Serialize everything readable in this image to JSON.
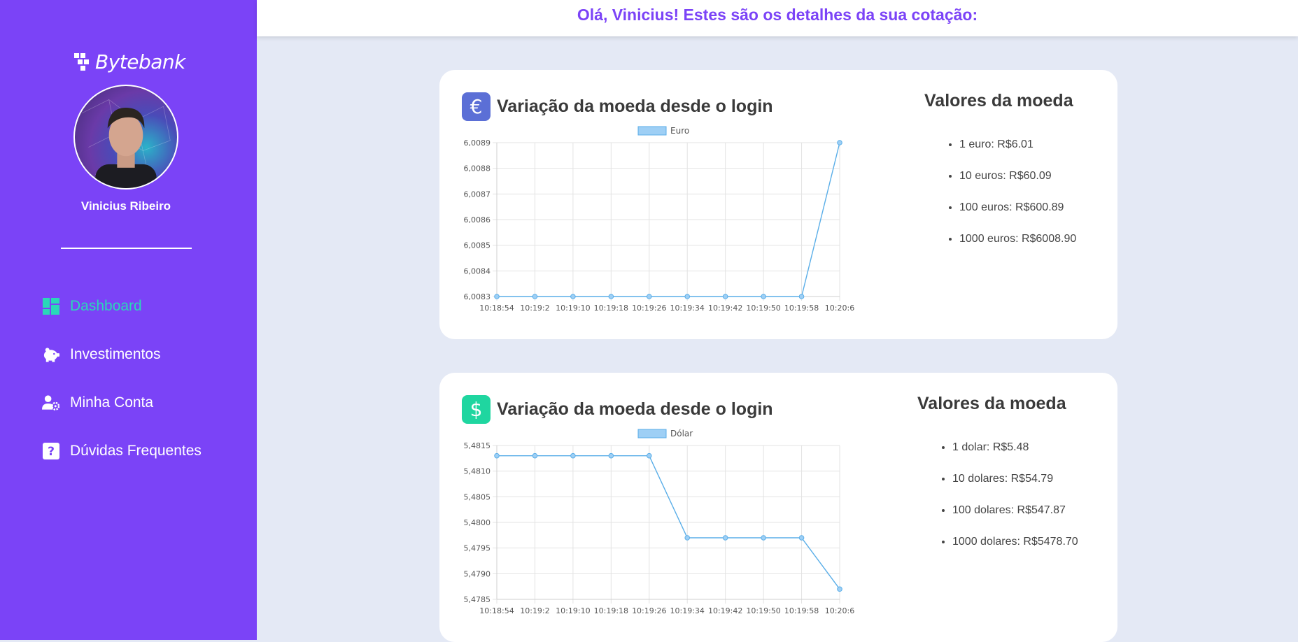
{
  "sidebar": {
    "brand": "Bytebank",
    "user_name": "Vinicius Ribeiro",
    "nav": [
      {
        "label": "Dashboard",
        "icon": "dashboard-icon",
        "active": true
      },
      {
        "label": "Investimentos",
        "icon": "piggy-bank-icon"
      },
      {
        "label": "Minha Conta",
        "icon": "user-gear-icon"
      },
      {
        "label": "Dúvidas Frequentes",
        "icon": "question-icon"
      }
    ]
  },
  "header": {
    "greeting": "Olá, Vinicius! Estes são os detalhes da sua cotação:"
  },
  "colors": {
    "accent": "#7b43f7",
    "active": "#2ad8b8",
    "euro_badge": "#5b6fd6",
    "dollar_badge": "#1fd6a0",
    "line": "#5aaee8",
    "legend_fill": "#9ecff5"
  },
  "cards": [
    {
      "title": "Variação da moeda desde o login",
      "badge": "€",
      "values_title": "Valores da moeda",
      "values": [
        "1 euro: R$6.01",
        "10 euros: R$60.09",
        "100 euros: R$600.89",
        "1000 euros: R$6008.90"
      ]
    },
    {
      "title": "Variação da moeda desde o login",
      "badge": "$",
      "values_title": "Valores da moeda",
      "values": [
        "1 dolar: R$5.48",
        "10 dolares: R$54.79",
        "100 dolares: R$547.87",
        "1000 dolares: R$5478.70"
      ]
    }
  ],
  "chart_data": [
    {
      "type": "line",
      "title": "",
      "x": [
        "10:18:54",
        "10:19:2",
        "10:19:10",
        "10:19:18",
        "10:19:26",
        "10:19:34",
        "10:19:42",
        "10:19:50",
        "10:19:58",
        "10:20:6"
      ],
      "series": [
        {
          "name": "Euro",
          "values": [
            6.0083,
            6.0083,
            6.0083,
            6.0083,
            6.0083,
            6.0083,
            6.0083,
            6.0083,
            6.0083,
            6.0089
          ]
        }
      ],
      "ylim": [
        6.0083,
        6.0089
      ],
      "yticks": [
        "6,0089",
        "6,0088",
        "6,0087",
        "6,0086",
        "6,0085",
        "6,0084",
        "6,0083"
      ],
      "grid": true,
      "legend": "top-center"
    },
    {
      "type": "line",
      "title": "",
      "x": [
        "10:18:54",
        "10:19:2",
        "10:19:10",
        "10:19:18",
        "10:19:26",
        "10:19:34",
        "10:19:42",
        "10:19:50",
        "10:19:58",
        "10:20:6"
      ],
      "series": [
        {
          "name": "Dólar",
          "values": [
            5.4813,
            5.4813,
            5.4813,
            5.4813,
            5.4813,
            5.4797,
            5.4797,
            5.4797,
            5.4797,
            5.4787
          ]
        }
      ],
      "ylim": [
        5.4785,
        5.4815
      ],
      "yticks": [
        "5,4815",
        "5,4810",
        "5,4805",
        "5,4800",
        "5,4795",
        "5,4790",
        "5,4785"
      ],
      "grid": true,
      "legend": "top-center"
    }
  ]
}
